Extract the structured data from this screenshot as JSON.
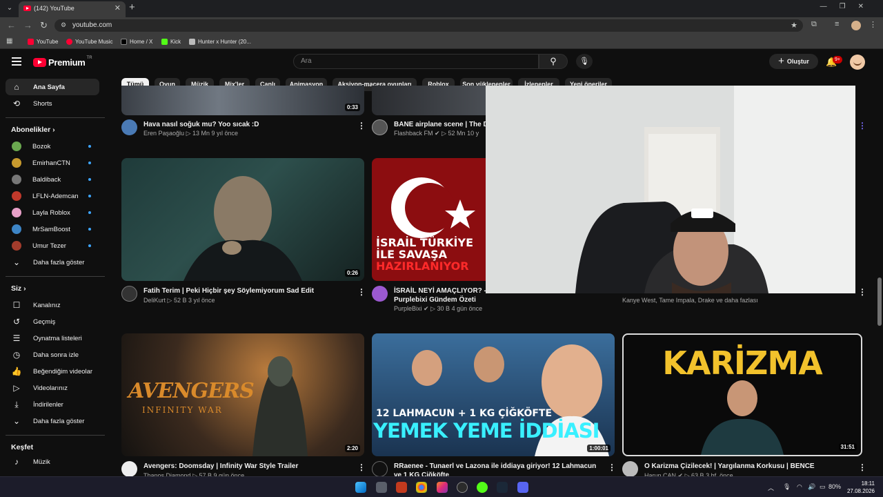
{
  "browser": {
    "tab_title": "(142) YouTube",
    "tab_close": "✕",
    "new_tab": "+",
    "url": "youtube.com",
    "bookmarks": [
      "YouTube",
      "YouTube Music",
      "Home / X",
      "Kick",
      "Hunter x Hunter (20..."
    ]
  },
  "header": {
    "logo": "Premium",
    "logo_tr": "TR",
    "search_placeholder": "Ara",
    "create_label": "Oluştur",
    "notif_badge": "9+"
  },
  "sidebar": {
    "main": [
      {
        "label": "Ana Sayfa",
        "icon": "home-icon"
      },
      {
        "label": "Shorts",
        "icon": "shorts-icon"
      }
    ],
    "subs_heading": "Abonelikler",
    "subs": [
      {
        "label": "Bozok",
        "color": "#6aa84f"
      },
      {
        "label": "EmirhanCTN",
        "color": "#c79a2e"
      },
      {
        "label": "Baldiback",
        "color": "#777777"
      },
      {
        "label": "LFLN-Ademcan",
        "color": "#c0392b"
      },
      {
        "label": "Layla Roblox",
        "color": "#e8a0c8"
      },
      {
        "label": "MrSamBoost",
        "color": "#3d85c6"
      },
      {
        "label": "Umur Tezer",
        "color": "#a33c2c"
      }
    ],
    "subs_more": "Daha fazla göster",
    "you_heading": "Siz",
    "you": [
      {
        "label": "Kanalınız",
        "icon": "channel-icon"
      },
      {
        "label": "Geçmiş",
        "icon": "history-icon"
      },
      {
        "label": "Oynatma listeleri",
        "icon": "playlists-icon"
      },
      {
        "label": "Daha sonra izle",
        "icon": "watch-later-icon"
      },
      {
        "label": "Beğendiğim videolar",
        "icon": "like-icon"
      },
      {
        "label": "Videolarınız",
        "icon": "your-videos-icon"
      },
      {
        "label": "İndirilenler",
        "icon": "download-icon"
      },
      {
        "label": "Daha fazla göster",
        "icon": "chevron-down-icon"
      }
    ],
    "explore_heading": "Keşfet",
    "explore": [
      {
        "label": "Müzik",
        "icon": "music-icon"
      }
    ]
  },
  "chips": [
    "Tümü",
    "Oyun",
    "Müzik",
    "Mix'ler",
    "Canlı",
    "Animasyon",
    "Aksiyon-macera oyunları",
    "Roblox",
    "Son yüklenenler",
    "İzlenenler",
    "Yeni öneriler"
  ],
  "videos": [
    {
      "title": "Hava nasıl soğuk mu? Yoo sıcak :D",
      "channel": "Eren Paşaoğlu",
      "views": "13 Mn",
      "age": "9 yıl önce",
      "duration": "0:33"
    },
    {
      "title": "BANE airplane scene | The D",
      "channel": "Flashback FM",
      "views": "52 Mn",
      "age": "10 y"
    },
    {
      "title": "Fatih Terim | Peki Hiçbir şey Söylemiyorum Sad Edit",
      "channel": "DeliKurt",
      "views": "52 B",
      "age": "3 yıl önce",
      "duration": "0:26"
    },
    {
      "title": "İSRAİL NEYİ AMAÇLIYOR? -",
      "title2": "Purplebixi Gündem Özeti",
      "channel": "PurpleBixi",
      "views": "30 B",
      "age": "4 gün önce",
      "thumb_text1": "İSRAİL TÜRKİYE",
      "thumb_text2": "İLE SAVAŞA",
      "thumb_text3": "HAZIRLANIYOR"
    },
    {
      "meta": "Kanye West, Tame Impala, Drake ve daha fazlası"
    },
    {
      "title": "Avengers: Doomsday | Infinity War Style Trailer",
      "channel": "Thanos Diamond",
      "views": "57 B",
      "age": "9 gün önce",
      "duration": "2:20",
      "thumb_text1": "AVENGERS",
      "thumb_text2": "INFINITY WAR"
    },
    {
      "title": "RRaenee - Tunaerl ve Lazona ile iddiaya giriyor! 12 Lahmacun",
      "title2": "ve 1 KG Çiğköfte",
      "duration": "1:00:01",
      "thumb_text1": "12 LAHMACUN + 1 KG ÇİĞKÖFTE",
      "thumb_text2": "YEMEK YEME İDDİASI"
    },
    {
      "title": "O Karizma Çizilecek! | Yargılanma Korkusu | BENCE",
      "channel": "Harun CAN",
      "views": "63 B",
      "age": "3 hf. önce",
      "duration": "31:51",
      "thumb_text1": "KARİZMA"
    }
  ],
  "taskbar": {
    "battery": "80%",
    "time": "18:11",
    "date": "27.08.2026"
  },
  "colors": {
    "bg": "#0f0f0f",
    "brand_red": "#ff0033",
    "chip_bg": "#272727",
    "meta_text": "#aaaaaa"
  }
}
